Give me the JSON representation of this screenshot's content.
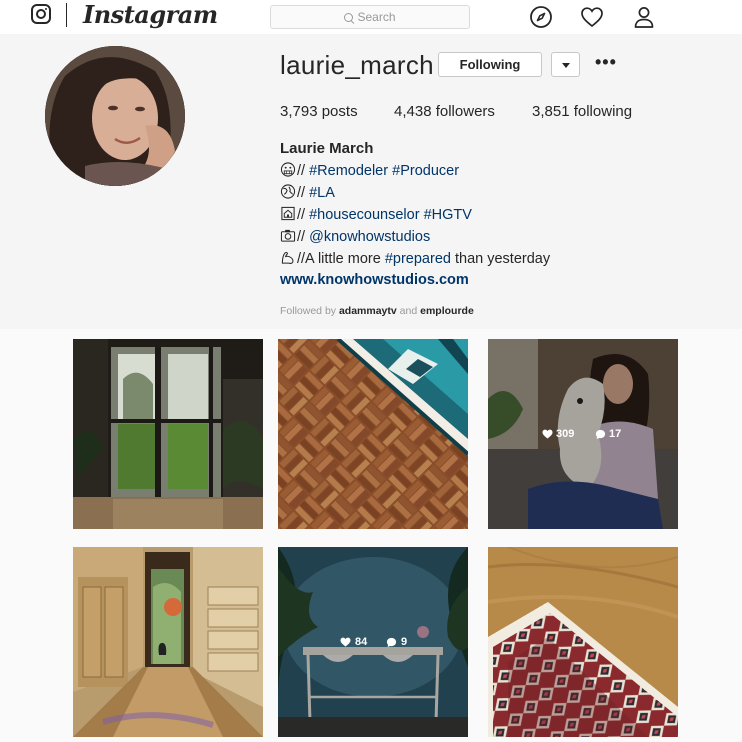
{
  "app": {
    "wordmark": "Instagram",
    "search_placeholder": "Search",
    "nav_icons": [
      "explore-compass-icon",
      "activity-heart-icon",
      "profile-person-icon"
    ]
  },
  "profile": {
    "username": "laurie_march",
    "follow_button_label": "Following",
    "more_options_label": "•••",
    "stats": {
      "posts_count": "3,793",
      "posts_label": "posts",
      "followers_count": "4,438",
      "followers_label": "followers",
      "following_count": "3,851",
      "following_label": "following"
    },
    "full_name": "Laurie March",
    "bio": [
      {
        "icon": "grimace-emoji",
        "prefix": "// ",
        "tags": [
          "#Remodeler",
          "#Producer"
        ],
        "suffix": ""
      },
      {
        "icon": "globe-emoji",
        "prefix": "// ",
        "tags": [
          "#LA"
        ],
        "suffix": ""
      },
      {
        "icon": "house-frame-emoji",
        "prefix": "// ",
        "tags": [
          "#housecounselor",
          "#HGTV"
        ],
        "suffix": ""
      },
      {
        "icon": "camera-emoji",
        "prefix": "// ",
        "tags": [
          "@knowhowstudios"
        ],
        "suffix": ""
      },
      {
        "icon": "flexed-arm-emoji",
        "prefix": "//A little more ",
        "tags": [
          "#prepared"
        ],
        "suffix": " than yesterday"
      }
    ],
    "website": "www.knowhowstudios.com",
    "followed_by": {
      "prefix": "Followed by",
      "user1": "adammaytv",
      "conjunction": "and",
      "user2": "emplourde"
    }
  },
  "grid": {
    "posts": [
      {
        "subject": "french-doors-garden",
        "likes": null,
        "comments": null
      },
      {
        "subject": "parquet-floor-rug",
        "likes": null,
        "comments": null
      },
      {
        "subject": "woman-with-dog",
        "likes": "309",
        "comments": "17"
      },
      {
        "subject": "hallway-cabinets",
        "likes": null,
        "comments": null
      },
      {
        "subject": "blue-wall-double-sink",
        "likes": "84",
        "comments": "9"
      },
      {
        "subject": "wood-floor-kilim-rug",
        "likes": null,
        "comments": null
      }
    ]
  },
  "colors": {
    "link": "#003569",
    "text": "#262626",
    "muted": "#999999",
    "page_bg": "#fafafa",
    "header_bg": "#f5f5f5"
  }
}
